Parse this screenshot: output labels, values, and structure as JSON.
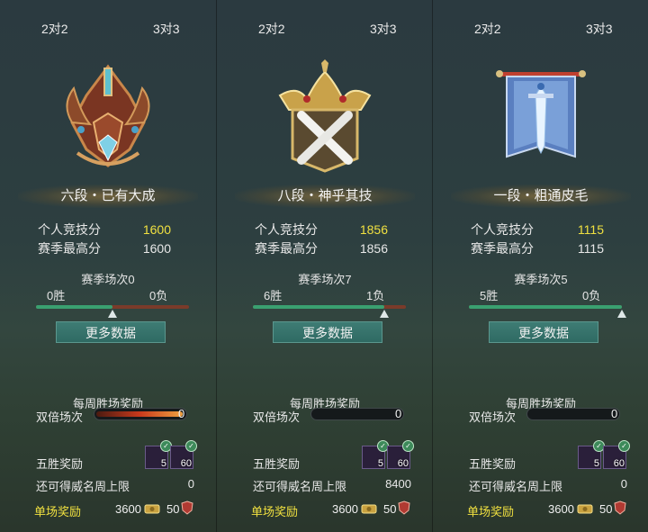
{
  "colors": {
    "accent_yellow": "#f0e040",
    "win_bar": "#3aa070",
    "loss_bar": "#7a3b2a",
    "button": "#2f6a63"
  },
  "panels": [
    {
      "tabs": [
        "2对2",
        "3对3"
      ],
      "emblem_icon": "bronze-rank-emblem-icon",
      "rank_title": "六段・已有大成",
      "personal_score_label": "个人竞技分",
      "personal_score": "1600",
      "season_high_label": "赛季最高分",
      "season_high": "1600",
      "season_matches": "赛季场次0",
      "wins": "0胜",
      "losses": "0负",
      "win_ratio": 0.5,
      "more_data": "更多数据",
      "weekly_reward": "每周胜场奖励",
      "double_label": "双倍场次",
      "double_value": "0",
      "five_win_label": "五胜奖励",
      "item1_count": "5",
      "item2_count": "60",
      "fame_cap_label": "还可得威名周上限",
      "fame_cap": "0",
      "single_label": "单场奖励",
      "single_coin": "3600",
      "single_fame": "50"
    },
    {
      "tabs": [
        "2对2",
        "3对3"
      ],
      "emblem_icon": "gold-crossed-swords-emblem-icon",
      "rank_title": "八段・神乎其技",
      "personal_score_label": "个人竞技分",
      "personal_score": "1856",
      "season_high_label": "赛季最高分",
      "season_high": "1856",
      "season_matches": "赛季场次7",
      "wins": "6胜",
      "losses": "1负",
      "win_ratio": 0.857,
      "more_data": "更多数据",
      "weekly_reward": "每周胜场奖励",
      "double_label": "双倍场次",
      "double_value": "0",
      "five_win_label": "五胜奖励",
      "item1_count": "5",
      "item2_count": "60",
      "fame_cap_label": "还可得威名周上限",
      "fame_cap": "8400",
      "single_label": "单场奖励",
      "single_coin": "3600",
      "single_fame": "50"
    },
    {
      "tabs": [
        "2对2",
        "3对3"
      ],
      "emblem_icon": "blue-banner-sword-emblem-icon",
      "rank_title": "一段・粗通皮毛",
      "personal_score_label": "个人竞技分",
      "personal_score": "1115",
      "season_high_label": "赛季最高分",
      "season_high": "1115",
      "season_matches": "赛季场次5",
      "wins": "5胜",
      "losses": "0负",
      "win_ratio": 1.0,
      "more_data": "更多数据",
      "weekly_reward": "每周胜场奖励",
      "double_label": "双倍场次",
      "double_value": "0",
      "five_win_label": "五胜奖励",
      "item1_count": "5",
      "item2_count": "60",
      "fame_cap_label": "还可得威名周上限",
      "fame_cap": "0",
      "single_label": "单场奖励",
      "single_coin": "3600",
      "single_fame": "50"
    }
  ]
}
